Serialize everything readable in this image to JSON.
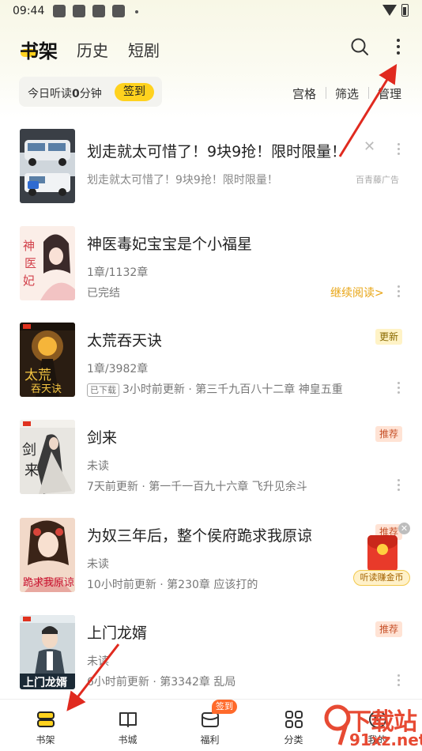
{
  "status_bar": {
    "time": "09:44"
  },
  "top_tabs": [
    {
      "label": "书架"
    },
    {
      "label": "历史"
    },
    {
      "label": "短剧"
    }
  ],
  "listen": {
    "prefix": "今日听读",
    "minutes": "0",
    "suffix": "分钟",
    "signin_label": "签到"
  },
  "view_options": [
    {
      "label": "宫格"
    },
    {
      "label": "筛选"
    },
    {
      "label": "管理"
    }
  ],
  "ad": {
    "title": "划走就太可惜了！9块9抢！限时限量！",
    "subtitle": "划走就太可惜了！9块9抢！限时限量！",
    "label": "百青藤广告",
    "close": "✕"
  },
  "books": [
    {
      "title": "神医毒妃宝宝是个小福星",
      "progress": "1章/1132章",
      "status": "已完结",
      "action": "继续阅读>"
    },
    {
      "title": "太荒吞天诀",
      "progress": "1章/3982章",
      "download_tag": "已下载",
      "update": "3小时前更新 · 第三千九百八十二章 神皇五重",
      "badge": "更新"
    },
    {
      "title": "剑来",
      "progress": "未读",
      "update": "7天前更新 · 第一千一百九十六章 飞升见余斗",
      "badge": "推荐"
    },
    {
      "title": "为奴三年后，整个侯府跪求我原谅",
      "progress": "未读",
      "update": "10小时前更新 · 第230章 应该打的",
      "badge": "推荐"
    },
    {
      "title": "上门龙婿",
      "progress": "未读",
      "update": "6小时前更新 · 第3342章 乱局",
      "badge": "推荐"
    }
  ],
  "floating": {
    "label": "听读赚金币",
    "close": "✕"
  },
  "bottom_nav": [
    {
      "label": "书架"
    },
    {
      "label": "书城"
    },
    {
      "label": "福利",
      "badge": "签到"
    },
    {
      "label": "分类"
    },
    {
      "label": "我的"
    }
  ],
  "watermark": {
    "text": "下载站",
    "url": "91xz.net"
  },
  "colors": {
    "accent": "#ffd21e",
    "annotation_arrow": "#e02a1f"
  }
}
